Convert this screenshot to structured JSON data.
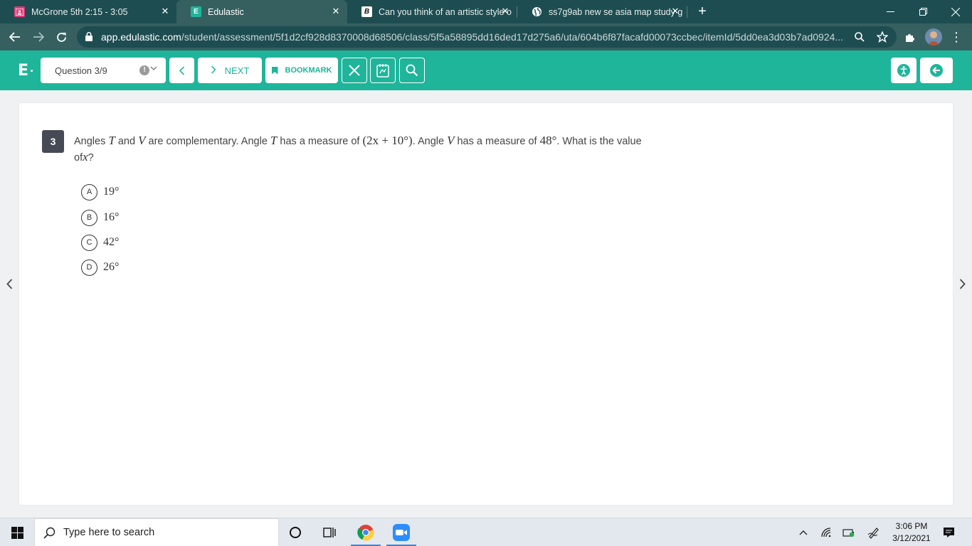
{
  "browser": {
    "tabs": [
      {
        "title": "McGrone 5th 2:15 - 3:05",
        "favicon": "classroom-icon",
        "color": "#e03c79"
      },
      {
        "title": "Edulastic",
        "favicon": "edulastic-icon",
        "color": "#1fb59b"
      },
      {
        "title": "Can you think of an artistic style o",
        "favicon": "brainly-icon",
        "color": "#111111"
      },
      {
        "title": "ss7g9ab new se asia map study g",
        "favicon": "globe-icon",
        "color": "#ffffff"
      }
    ],
    "active_tab": 1,
    "url_host": "app.edulastic.com",
    "url_path": "/student/assessment/5f1d2cf928d8370008d68506/class/5f5a58895dd16ded17d275a6/uta/604b6f87facafd00073ccbec/itemId/5dd0ea3d03b7ad0924..."
  },
  "header": {
    "question_selector": "Question 3/9",
    "warn_glyph": "!",
    "next_label": "NEXT",
    "bookmark_label": "BOOKMARK",
    "accent": "#1fb59b"
  },
  "question": {
    "number": "3",
    "text": {
      "p1": "Angles ",
      "m1": "T",
      "p2": " and ",
      "m2": "V",
      "p3": " are complementary. Angle ",
      "m3": "T",
      "p4": " has a measure of ",
      "e1": "(2x + 10°)",
      "p5": ". Angle ",
      "m4": "V",
      "p6": " has a measure of ",
      "e2": "48°",
      "p7": ". What is the value of",
      "m5": "x",
      "p8": "?"
    },
    "choices": [
      {
        "letter": "A",
        "value": "19°"
      },
      {
        "letter": "B",
        "value": "16°"
      },
      {
        "letter": "C",
        "value": "42°"
      },
      {
        "letter": "D",
        "value": "26°"
      }
    ]
  },
  "taskbar": {
    "search_placeholder": "Type here to search",
    "time": "3:06 PM",
    "date": "3/12/2021"
  }
}
